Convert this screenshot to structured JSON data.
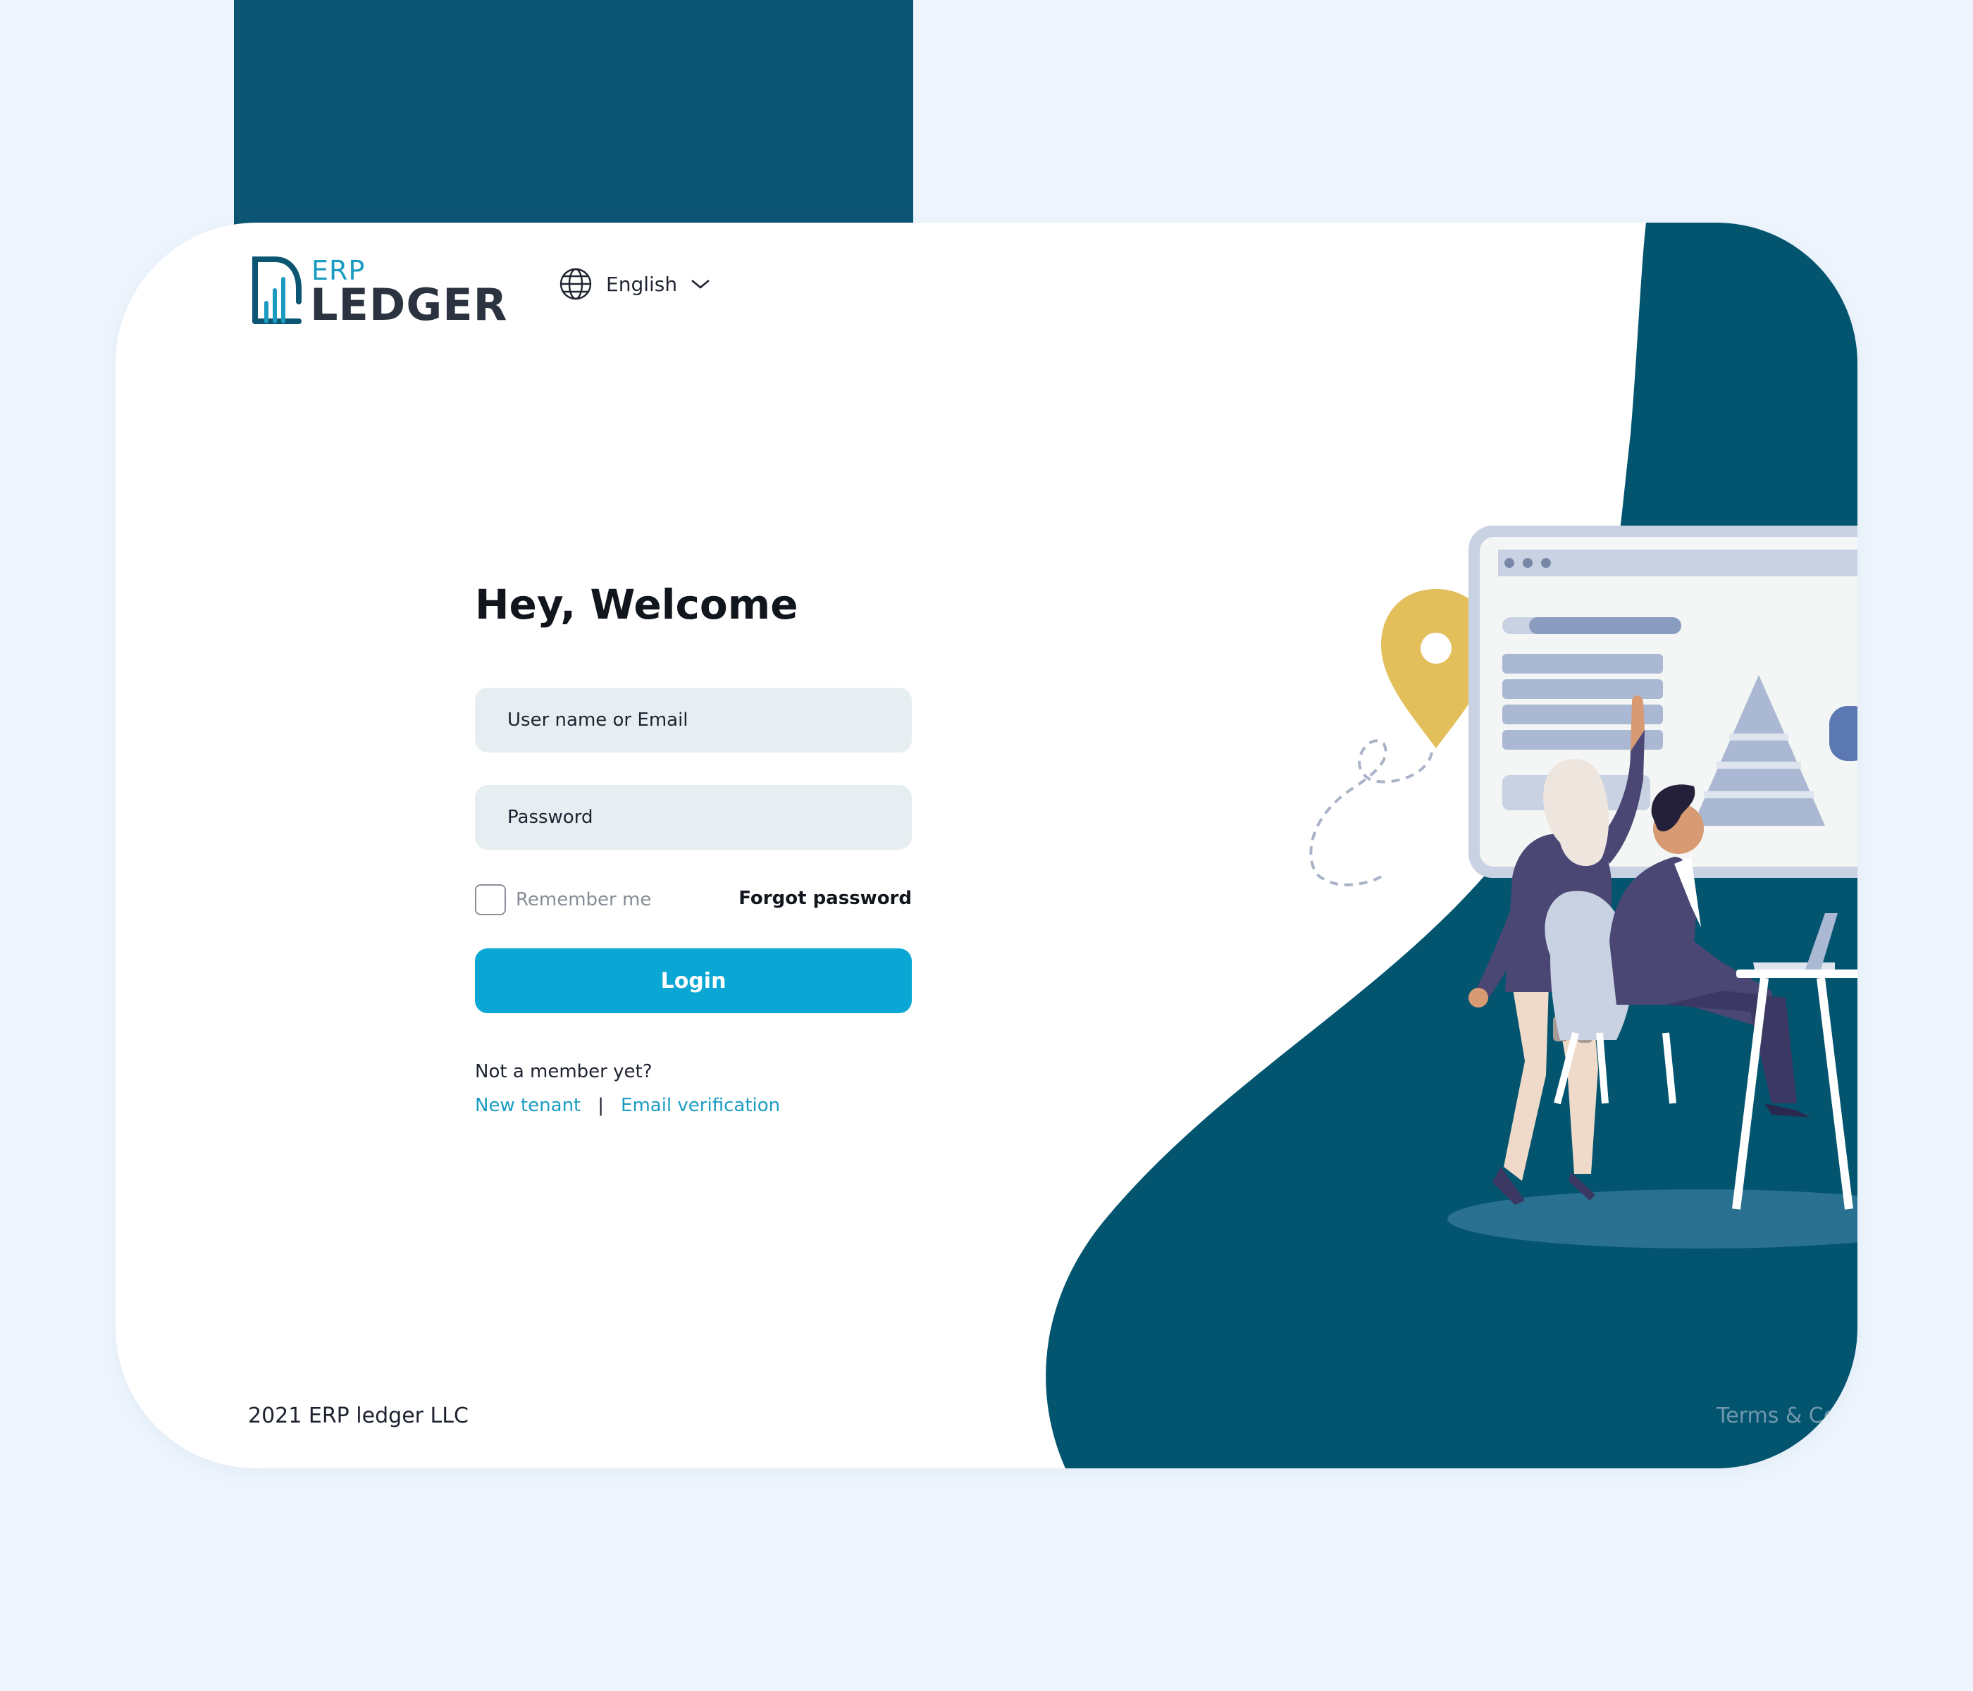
{
  "brand": {
    "erp": "ERP",
    "ledger": "LEDGER"
  },
  "language": {
    "selected": "English",
    "icon": "globe-icon",
    "caret_icon": "chevron-down-icon"
  },
  "login": {
    "heading": "Hey, Welcome",
    "username_placeholder": "User name or Email",
    "password_placeholder": "Password",
    "remember_label": "Remember me",
    "forgot_label": "Forgot password",
    "submit_label": "Login"
  },
  "signup": {
    "prompt": "Not a member yet?",
    "new_tenant": "New tenant",
    "separator": "|",
    "email_verification": "Email verification"
  },
  "footer": {
    "copyright": "2021 ERP ledger LLC",
    "terms": "Terms & Co"
  },
  "colors": {
    "primary": "#0aa6d4",
    "brand_dark": "#0c5573",
    "illustration_bg": "#03546f",
    "page_bg": "#eef5fd",
    "accent_yellow": "#e2bf5b"
  }
}
